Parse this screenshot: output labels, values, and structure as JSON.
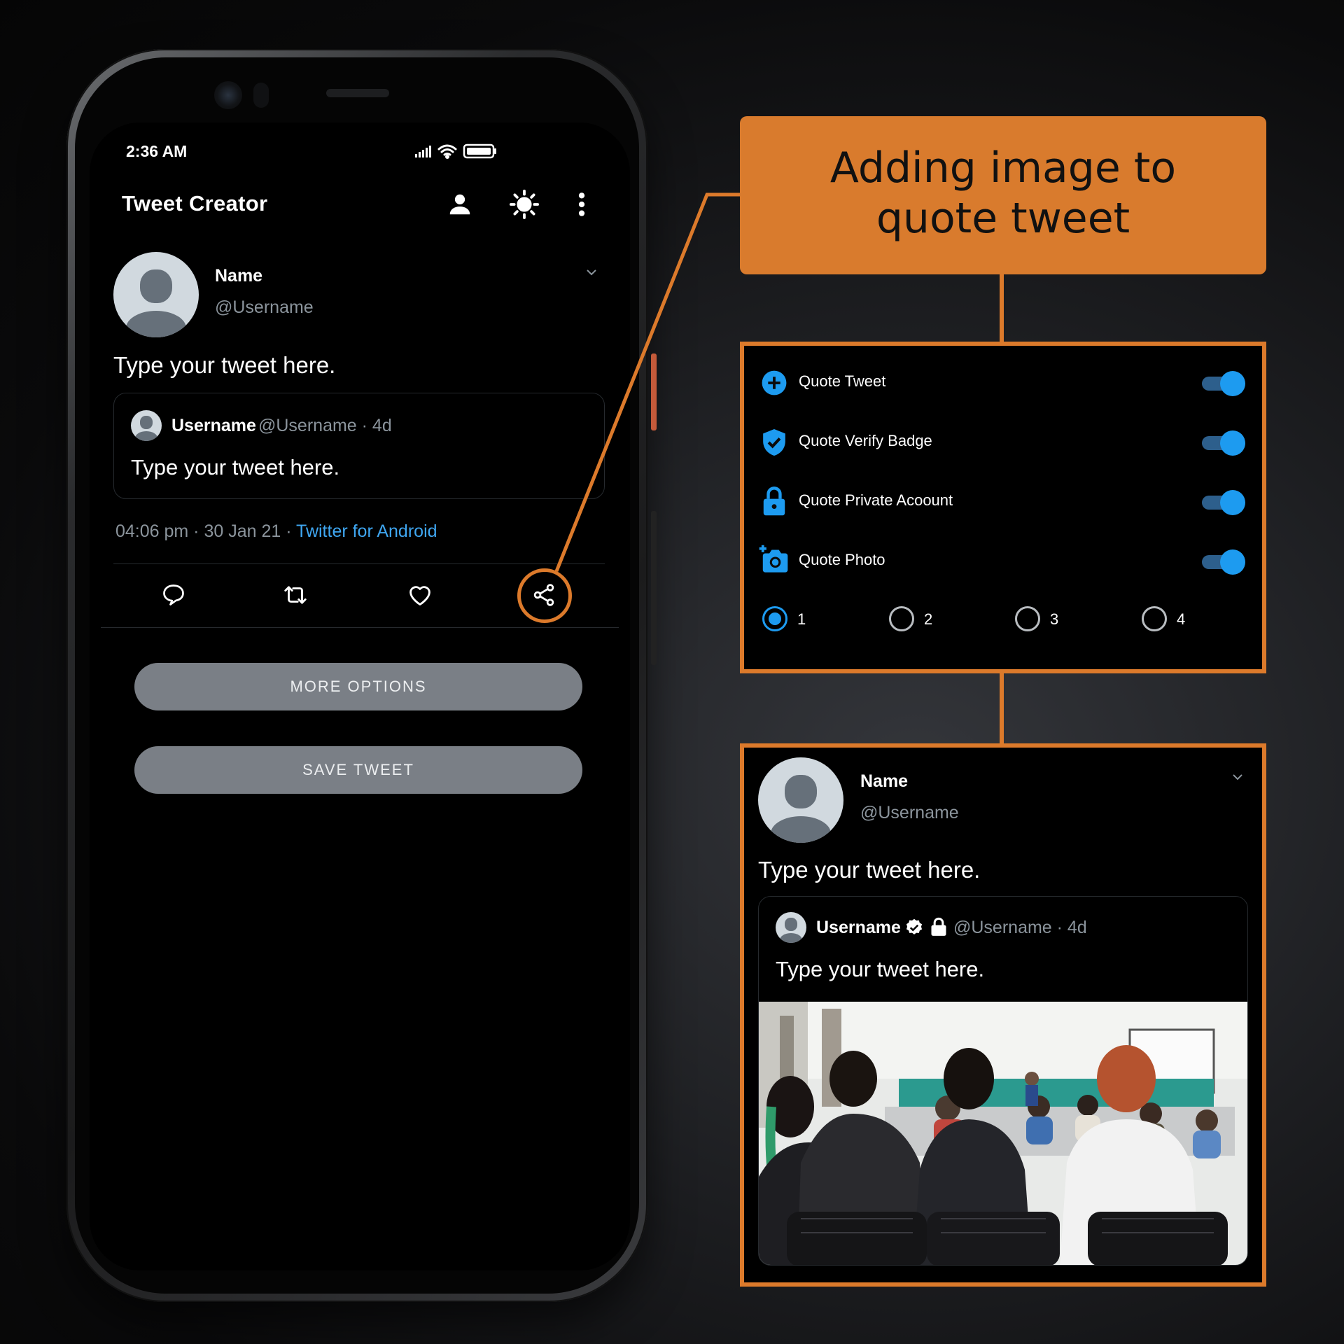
{
  "status_bar": {
    "time": "2:36 AM"
  },
  "app": {
    "title": "Tweet Creator"
  },
  "tweet": {
    "name": "Name",
    "handle": "@Username",
    "text": "Type your tweet here.",
    "quote": {
      "username": "Username",
      "handle_time": "@Username · 4d",
      "text": "Type your tweet here."
    },
    "meta_time": "04:06 pm · 30 Jan 21 · ",
    "meta_source": "Twitter for Android"
  },
  "buttons": {
    "more_options": "MORE OPTIONS",
    "save_tweet": "SAVE TWEET"
  },
  "callout": {
    "line1": "Adding image to",
    "line2": "quote tweet"
  },
  "options": {
    "items": [
      {
        "label": "Quote Tweet",
        "icon": "plus-circle-icon",
        "enabled": true
      },
      {
        "label": "Quote Verify Badge",
        "icon": "verified-shield-icon",
        "enabled": true
      },
      {
        "label": "Quote Private Acoount",
        "icon": "lock-icon",
        "enabled": true
      },
      {
        "label": "Quote Photo",
        "icon": "add-photo-icon",
        "enabled": true
      }
    ],
    "photo_count": {
      "options": [
        "1",
        "2",
        "3",
        "4"
      ],
      "selected": "1"
    }
  },
  "preview": {
    "name": "Name",
    "handle": "@Username",
    "text": "Type your tweet here.",
    "quote": {
      "username": "Username",
      "handle_time": "@Username · 4d",
      "text": "Type your tweet here."
    }
  },
  "colors": {
    "accent_orange": "#dc7a2b",
    "twitter_blue": "#1d9bf0",
    "link_blue": "#3fa7f2",
    "button_gray": "#7a7f86"
  }
}
